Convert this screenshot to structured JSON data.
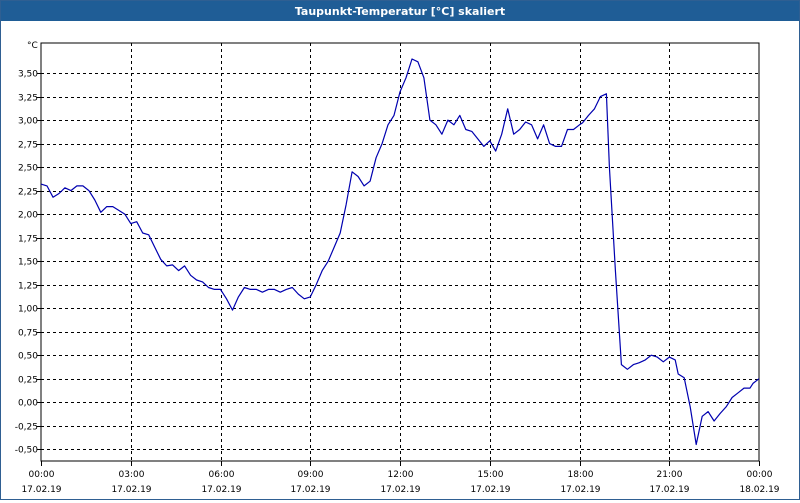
{
  "window": {
    "title": "Taupunkt-Temperatur [°C] skaliert"
  },
  "chart_data": {
    "type": "line",
    "title": "Taupunkt-Temperatur [°C] skaliert",
    "ylabel": "°C",
    "xlabel": "",
    "ylim": [
      -0.625,
      3.82
    ],
    "xlim_hours": [
      0,
      24
    ],
    "grid": true,
    "y_ticks": [
      "-0,50",
      "-0,25",
      "0,00",
      "0,25",
      "0,50",
      "0,75",
      "1,00",
      "1,25",
      "1,50",
      "1,75",
      "2,00",
      "2,25",
      "2,50",
      "2,75",
      "3,00",
      "3,25",
      "3,50"
    ],
    "x_ticks": [
      {
        "time": "00:00",
        "date": "17.02.19"
      },
      {
        "time": "03:00",
        "date": "17.02.19"
      },
      {
        "time": "06:00",
        "date": "17.02.19"
      },
      {
        "time": "09:00",
        "date": "17.02.19"
      },
      {
        "time": "12:00",
        "date": "17.02.19"
      },
      {
        "time": "15:00",
        "date": "17.02.19"
      },
      {
        "time": "18:00",
        "date": "17.02.19"
      },
      {
        "time": "21:00",
        "date": "17.02.19"
      },
      {
        "time": "00:00",
        "date": "18.02.19"
      }
    ],
    "series": [
      {
        "color": "#0000b0",
        "x_hours": [
          0.0,
          0.2,
          0.4,
          0.6,
          0.8,
          1.0,
          1.2,
          1.4,
          1.6,
          1.8,
          2.0,
          2.2,
          2.4,
          2.6,
          2.8,
          3.0,
          3.2,
          3.4,
          3.6,
          3.8,
          4.0,
          4.2,
          4.4,
          4.6,
          4.8,
          5.0,
          5.2,
          5.4,
          5.6,
          5.8,
          6.0,
          6.2,
          6.4,
          6.6,
          6.8,
          7.0,
          7.2,
          7.4,
          7.6,
          7.8,
          8.0,
          8.2,
          8.4,
          8.6,
          8.8,
          9.0,
          9.2,
          9.4,
          9.6,
          9.8,
          10.0,
          10.2,
          10.4,
          10.6,
          10.8,
          11.0,
          11.2,
          11.4,
          11.6,
          11.8,
          12.0,
          12.2,
          12.4,
          12.6,
          12.8,
          13.0,
          13.2,
          13.4,
          13.6,
          13.8,
          14.0,
          14.2,
          14.4,
          14.6,
          14.8,
          15.0,
          15.2,
          15.4,
          15.6,
          15.8,
          16.0,
          16.2,
          16.4,
          16.6,
          16.8,
          17.0,
          17.2,
          17.4,
          17.6,
          17.8,
          18.0,
          18.1,
          18.3,
          18.5,
          18.7,
          18.9,
          19.0,
          19.2,
          19.4,
          19.6,
          19.8,
          20.0,
          20.2,
          20.4,
          20.6,
          20.8,
          21.0,
          21.2,
          21.3,
          21.5,
          21.7,
          21.9,
          22.1,
          22.3,
          22.5,
          22.7,
          22.9,
          23.1,
          23.3,
          23.5,
          23.7,
          23.8,
          24.0
        ],
        "values": [
          2.32,
          2.3,
          2.18,
          2.22,
          2.28,
          2.25,
          2.3,
          2.3,
          2.25,
          2.15,
          2.02,
          2.08,
          2.08,
          2.04,
          2.0,
          1.9,
          1.92,
          1.8,
          1.78,
          1.65,
          1.52,
          1.45,
          1.46,
          1.4,
          1.45,
          1.35,
          1.3,
          1.28,
          1.22,
          1.2,
          1.2,
          1.1,
          0.98,
          1.12,
          1.22,
          1.2,
          1.2,
          1.17,
          1.2,
          1.2,
          1.17,
          1.2,
          1.22,
          1.15,
          1.1,
          1.12,
          1.25,
          1.4,
          1.5,
          1.65,
          1.8,
          2.1,
          2.45,
          2.4,
          2.3,
          2.35,
          2.6,
          2.75,
          2.95,
          3.05,
          3.3,
          3.45,
          3.65,
          3.62,
          3.45,
          3.0,
          2.95,
          2.85,
          3.0,
          2.95,
          3.05,
          2.9,
          2.88,
          2.8,
          2.72,
          2.78,
          2.67,
          2.85,
          3.12,
          2.85,
          2.9,
          2.98,
          2.95,
          2.8,
          2.95,
          2.75,
          2.72,
          2.72,
          2.9,
          2.9,
          2.95,
          2.97,
          3.05,
          3.12,
          3.25,
          3.28,
          2.5,
          1.4,
          0.4,
          0.35,
          0.4,
          0.42,
          0.45,
          0.5,
          0.48,
          0.43,
          0.48,
          0.45,
          0.3,
          0.26,
          -0.05,
          -0.45,
          -0.15,
          -0.1,
          -0.2,
          -0.12,
          -0.05,
          0.05,
          0.1,
          0.15,
          0.15,
          0.2,
          0.25,
          0.15,
          0.1
        ]
      }
    ]
  }
}
